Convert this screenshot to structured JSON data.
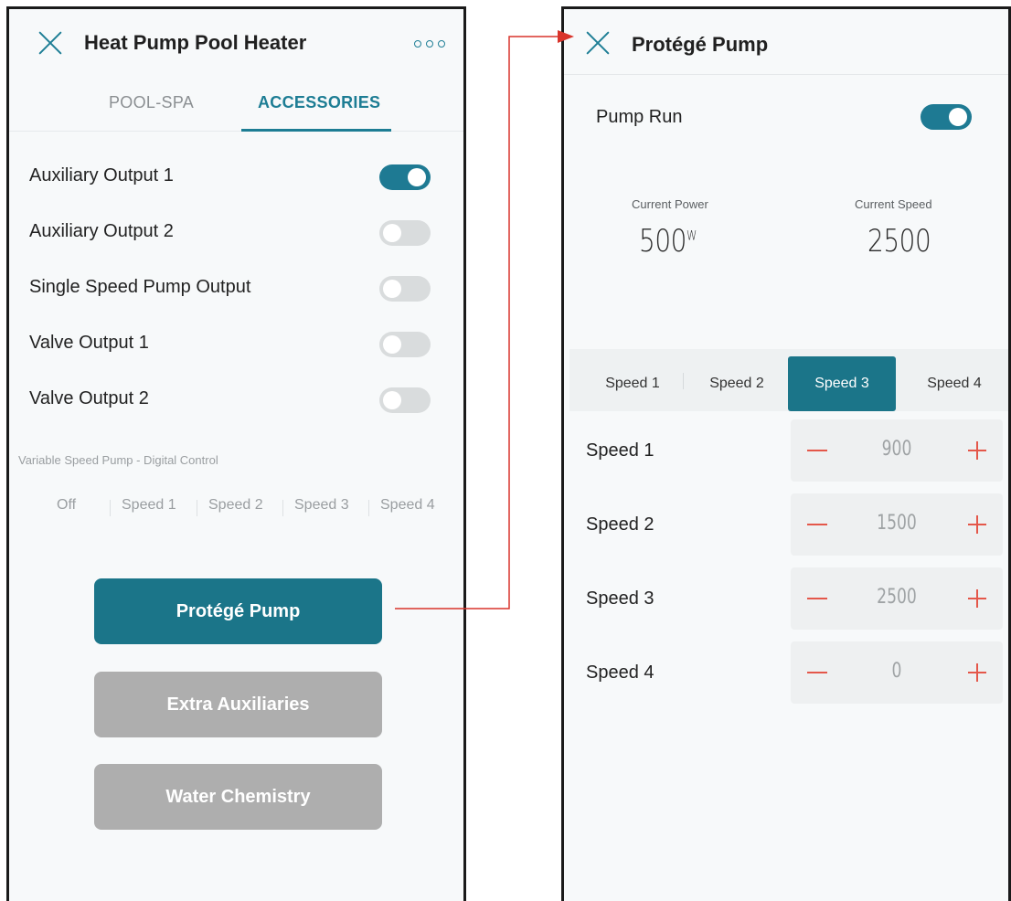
{
  "left": {
    "title": "Heat Pump Pool Heater",
    "tabs": [
      {
        "label": "POOL-SPA",
        "active": false
      },
      {
        "label": "ACCESSORIES",
        "active": true
      }
    ],
    "outputs": [
      {
        "label": "Auxiliary Output 1",
        "on": true
      },
      {
        "label": "Auxiliary Output 2",
        "on": false
      },
      {
        "label": "Single Speed Pump Output",
        "on": false
      },
      {
        "label": "Valve Output 1",
        "on": false
      },
      {
        "label": "Valve Output 2",
        "on": false
      }
    ],
    "vsp_caption": "Variable Speed Pump - Digital Control",
    "vsp_options": [
      "Off",
      "Speed 1",
      "Speed 2",
      "Speed 3",
      "Speed 4"
    ],
    "buttons": [
      {
        "label": "Protégé Pump",
        "state": "active"
      },
      {
        "label": "Extra Auxiliaries",
        "state": "disabled"
      },
      {
        "label": "Water Chemistry",
        "state": "disabled"
      }
    ]
  },
  "right": {
    "title": "Protégé Pump",
    "pump_run": {
      "label": "Pump Run",
      "on": true
    },
    "current_power": {
      "label": "Current Power",
      "value": "500",
      "unit": "W"
    },
    "current_speed": {
      "label": "Current Speed",
      "value": "2500"
    },
    "speed_tabs": [
      "Speed 1",
      "Speed 2",
      "Speed 3",
      "Speed 4"
    ],
    "selected_speed_tab": "Speed 3",
    "speeds": [
      {
        "label": "Speed 1",
        "value": "900"
      },
      {
        "label": "Speed 2",
        "value": "1500"
      },
      {
        "label": "Speed 3",
        "value": "2500"
      },
      {
        "label": "Speed 4",
        "value": "0"
      }
    ]
  },
  "colors": {
    "accent": "#1b7589",
    "connector_arrow": "#d9342b",
    "stepper_icon": "#e4574a",
    "disabled_button": "#aeaeae"
  }
}
